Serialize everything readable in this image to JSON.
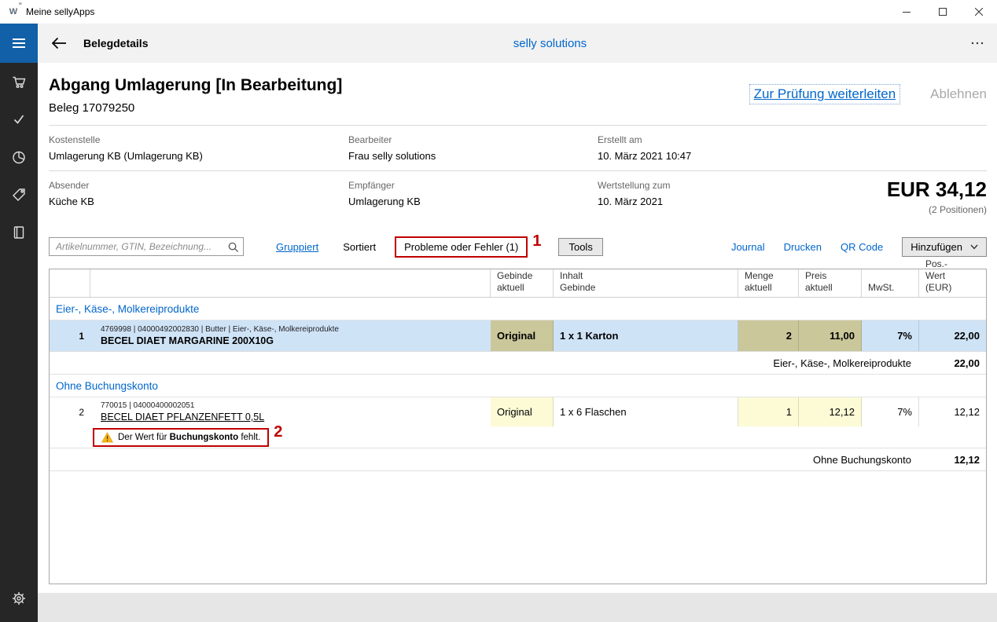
{
  "titlebar": {
    "logo": "W",
    "title": "Meine sellyApps"
  },
  "appbar": {
    "title": "Belegdetails",
    "center_title": "selly solutions"
  },
  "icons": {
    "titlebar": [
      "app-logo-icon",
      "minimize-icon",
      "maximize-icon",
      "close-icon"
    ],
    "sidebar": [
      "menu-icon",
      "cart-icon",
      "check-icon",
      "pie-chart-icon",
      "tag-icon",
      "book-icon",
      "gear-icon"
    ],
    "appbar": [
      "back-arrow-icon",
      "more-ellipsis-icon"
    ],
    "toolbar": [
      "search-icon",
      "chevron-down-icon"
    ],
    "table": [
      "warning-triangle-icon"
    ]
  },
  "doc": {
    "title": "Abgang Umlagerung [In Bearbeitung]",
    "subtitle": "Beleg 17079250",
    "action_forward": "Zur Prüfung weiterleiten",
    "action_reject": "Ablehnen",
    "fields": {
      "kostenstelle_label": "Kostenstelle",
      "kostenstelle_value": "Umlagerung KB (Umlagerung KB)",
      "bearbeiter_label": "Bearbeiter",
      "bearbeiter_value": "Frau selly solutions",
      "erstellt_label": "Erstellt am",
      "erstellt_value": "10. März 2021 10:47",
      "absender_label": "Absender",
      "absender_value": "Küche KB",
      "empfaenger_label": "Empfänger",
      "empfaenger_value": "Umlagerung KB",
      "wertstellung_label": "Wertstellung zum",
      "wertstellung_value": "10. März 2021"
    },
    "total_amount": "EUR 34,12",
    "total_positions": "(2 Positionen)"
  },
  "toolbar": {
    "search_placeholder": "Artikelnummer, GTIN, Bezeichnung...",
    "gruppiert": "Gruppiert",
    "sortiert": "Sortiert",
    "probleme": "Probleme oder Fehler (1)",
    "tools": "Tools",
    "journal": "Journal",
    "drucken": "Drucken",
    "qr_code": "QR Code",
    "hinzufuegen": "Hinzufügen"
  },
  "table": {
    "headers": {
      "gebinde": "Gebinde aktuell",
      "inhalt": "Inhalt Gebinde",
      "menge": "Menge aktuell",
      "preis": "Preis aktuell",
      "mwst": "MwSt.",
      "wert": "Pos.-Wert (EUR)"
    },
    "groups": [
      {
        "title": "Eier-, Käse-, Molkereiprodukte",
        "subtotal_label": "Eier-, Käse-, Molkereiprodukte",
        "subtotal_value": "22,00",
        "rows": [
          {
            "pos": "1",
            "meta": "4769998 | 04000492002830 | Butter | Eier-, Käse-, Molkereiprodukte",
            "name": "BECEL DIAET MARGARINE 200X10G",
            "gebinde": "Original",
            "inhalt": "1 x 1 Karton",
            "menge": "2",
            "preis": "11,00",
            "mwst": "7%",
            "wert": "22,00"
          }
        ]
      },
      {
        "title": "Ohne Buchungskonto",
        "subtotal_label": "Ohne Buchungskonto",
        "subtotal_value": "12,12",
        "rows": [
          {
            "pos": "2",
            "meta": "770015 | 04000400002051",
            "name": "BECEL DIAET PFLANZENFETT 0,5L",
            "gebinde": "Original",
            "inhalt": "1 x 6 Flaschen",
            "menge": "1",
            "preis": "12,12",
            "mwst": "7%",
            "wert": "12,12",
            "warning_prefix": "Der Wert für ",
            "warning_bold": "Buchungskonto",
            "warning_suffix": " fehlt."
          }
        ]
      }
    ]
  },
  "annotations": {
    "marker1": "1",
    "marker2": "2"
  }
}
